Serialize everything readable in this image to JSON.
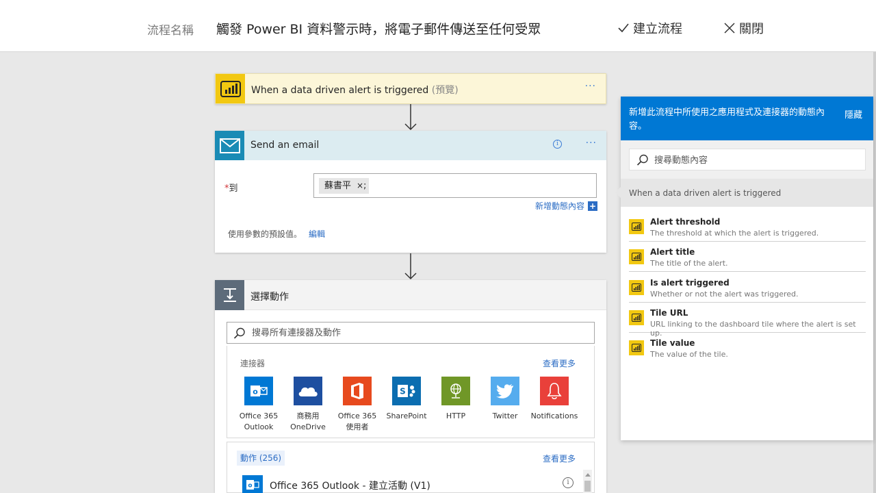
{
  "header": {
    "flow_name_label": "流程名稱",
    "flow_name_value": "觸發 Power BI 資料警示時，將電子郵件傳送至任何受眾",
    "create_label": "建立流程",
    "close_label": "關閉"
  },
  "trigger": {
    "title": "When a data driven alert is triggered",
    "preview": "(預覽)",
    "more": "···",
    "icon": "power-bi-icon",
    "color": "#f2c811"
  },
  "send_email": {
    "title": "Send an email",
    "info": "i",
    "more": "···",
    "icon": "mail-icon",
    "color": "#1a8bb5",
    "to_required": "*",
    "to_label": "到",
    "recipient_chip": "蘇書平",
    "chip_remove": "×",
    "separator": ";",
    "add_dynamic_content": "新增動態內容",
    "add_plus": "+",
    "defaults_text": "使用參數的預設值。",
    "defaults_edit": "編輯"
  },
  "choose_action": {
    "title": "選擇動作",
    "search_placeholder": "搜尋所有連接器及動作",
    "connectors_label": "連接器",
    "connectors_see_more": "查看更多",
    "connectors": [
      {
        "label": "Office 365\nOutlook",
        "icon": "outlook-icon",
        "color": "#0078d4"
      },
      {
        "label": "商務用\nOneDrive",
        "icon": "onedrive-icon",
        "color": "#1e4fa0"
      },
      {
        "label": "Office 365\n使用者",
        "icon": "office-icon",
        "color": "#e74a1e"
      },
      {
        "label": "SharePoint",
        "icon": "sharepoint-icon",
        "color": "#036c70"
      },
      {
        "label": "HTTP",
        "icon": "globe-icon",
        "color": "#709727"
      },
      {
        "label": "Twitter",
        "icon": "twitter-icon",
        "color": "#55acee"
      },
      {
        "label": "Notifications",
        "icon": "bell-icon",
        "color": "#e9403a"
      }
    ],
    "actions_label": "動作 (256)",
    "actions_see_more": "查看更多",
    "actions": [
      {
        "label": "Office 365 Outlook - 建立活動 (V1)",
        "icon": "outlook-icon",
        "info": "i"
      }
    ]
  },
  "dynamic_content": {
    "header_text": "新增此流程中所使用之應用程式及連接器的動態內容。",
    "hide_label": "隱藏",
    "search_placeholder": "搜尋動態內容",
    "group_title": "When a data driven alert is triggered",
    "items": [
      {
        "name": "Alert threshold",
        "desc": "The threshold at which the alert is triggered."
      },
      {
        "name": "Alert title",
        "desc": "The title of the alert."
      },
      {
        "name": "Is alert triggered",
        "desc": "Whether or not the alert was triggered."
      },
      {
        "name": "Tile URL",
        "desc": "URL linking to the dashboard tile where the alert is set up."
      },
      {
        "name": "Tile value",
        "desc": "The value of the tile."
      }
    ]
  }
}
